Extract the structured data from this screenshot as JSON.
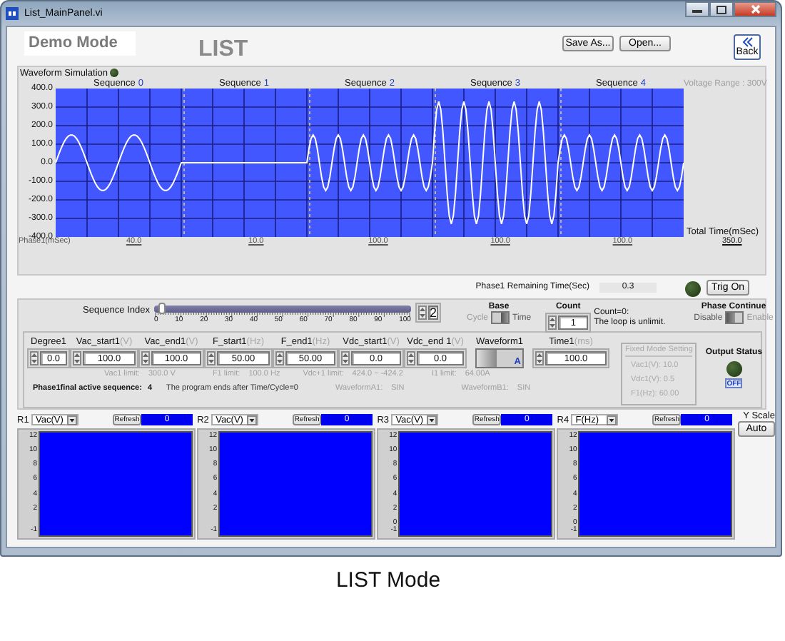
{
  "window": {
    "title": "List_MainPanel.vi"
  },
  "header": {
    "mode": "Demo Mode",
    "title": "LIST",
    "buttons": [
      "Save As...",
      "Open..."
    ],
    "back": "Back"
  },
  "waveform": {
    "label": "Waveform Simulation",
    "lit": false,
    "voltage_range": "Voltage Range : 300V",
    "sequences": [
      {
        "label": "Sequence",
        "number": "0",
        "duration": "40.0"
      },
      {
        "label": "Sequence",
        "number": "1",
        "duration": "10.0"
      },
      {
        "label": "Sequence",
        "number": "2",
        "duration": "100.0"
      },
      {
        "label": "Sequence",
        "number": "3",
        "duration": "100.0"
      },
      {
        "label": "Sequence",
        "number": "4",
        "duration": "100.0"
      }
    ],
    "y_ticks": [
      "400.0",
      "300.0",
      "200.0",
      "100.0",
      "0.0",
      "-100.0",
      "-200.0",
      "-300.0",
      "-400.0"
    ],
    "total_time_label": "Total Time(mSec)",
    "total_time": "350.0",
    "phase_label": "Phase1(mSec)"
  },
  "remaining": {
    "label": "Phase1 Remaining Time(Sec)",
    "value": "0.3"
  },
  "trigger": {
    "lit": false,
    "button": "Trig On"
  },
  "sequence_index": {
    "label": "Sequence Index",
    "level": 0.02,
    "ticks": [
      "0",
      "10",
      "20",
      "30",
      "40",
      "50",
      "60",
      "70",
      "80",
      "90",
      "100"
    ],
    "value": "2"
  },
  "base": {
    "label": "Base",
    "options": [
      {
        "label": "Cycle",
        "selected": false
      },
      {
        "label": "Time",
        "selected": true
      }
    ]
  },
  "count": {
    "label": "Count",
    "value": "1",
    "note": [
      "Count=0:",
      "The loop is unlimit."
    ]
  },
  "phase_continue": {
    "label": "Phase Continue",
    "options": [
      {
        "label": "Disable",
        "selected": true
      },
      {
        "label": "Enable",
        "selected": false
      }
    ]
  },
  "params": [
    {
      "kind": "numeric",
      "label": "Degree1",
      "value": "0.0"
    },
    {
      "kind": "numeric",
      "label": "Vac_start1",
      "unit": "(V)",
      "value": "100.0"
    },
    {
      "kind": "numeric",
      "label": "Vac_end1",
      "unit": "(V)",
      "value": "100.0"
    },
    {
      "kind": "numeric",
      "label": "F_start1",
      "unit": "(Hz)",
      "value": "50.00"
    },
    {
      "kind": "numeric",
      "label": "F_end1",
      "unit": "(Hz)",
      "value": "50.00"
    },
    {
      "kind": "numeric",
      "label": "Vdc_start1",
      "unit": "(V)",
      "value": "0.0"
    },
    {
      "kind": "numeric",
      "label": "Vdc_end 1",
      "unit": "(V)",
      "value": "0.0"
    },
    {
      "kind": "toggle",
      "label": "Waveform1",
      "option": "A",
      "on": false
    },
    {
      "kind": "numeric",
      "label": "Time1",
      "unit": "(ms)",
      "value": "100.0"
    }
  ],
  "limits": [
    {
      "label": "Vac1 limit:",
      "value": "300.0 V"
    },
    {
      "label": "F1 limit:",
      "value": "100.0 Hz"
    },
    {
      "label": "Vdc+1 limit:",
      "value": "424.0 ~ -424.2"
    },
    {
      "label": "I1 limit:",
      "value": "64.00A"
    }
  ],
  "info": {
    "active_label": "Phase1final active sequence:",
    "active_value": "4",
    "program_note": "The program ends after Time/Cycle=0",
    "waveforms": [
      {
        "label": "WaveformA1:",
        "value": "SIN"
      },
      {
        "label": "WaveformB1:",
        "value": "SIN"
      }
    ]
  },
  "fixed_mode": {
    "title": "Fixed Mode Setting",
    "disabled": true,
    "rows": [
      "Vac1(V):  10.0",
      "Vdc1(V):  0.5",
      "F1(Hz):  60.00"
    ]
  },
  "output": {
    "label": "Output Status",
    "lit": false,
    "button": "OFF"
  },
  "readouts": [
    {
      "label": "R1",
      "channel": "Vac(V)",
      "refresh": "Refresh",
      "value": "0",
      "ticks": [
        "12",
        "10",
        "8",
        "6",
        "4",
        "2",
        "-1"
      ]
    },
    {
      "label": "R2",
      "channel": "Vac(V)",
      "refresh": "Refresh",
      "value": "0",
      "ticks": [
        "12",
        "10",
        "8",
        "6",
        "4",
        "2",
        "-1"
      ]
    },
    {
      "label": "R3",
      "channel": "Vac(V)",
      "refresh": "Refresh",
      "value": "0",
      "ticks": [
        "12",
        "10",
        "8",
        "6",
        "4",
        "2",
        "0",
        "-1"
      ]
    },
    {
      "label": "R4",
      "channel": "F(Hz)",
      "refresh": "Refresh",
      "value": "0",
      "ticks": [
        "12",
        "10",
        "8",
        "6",
        "4",
        "2",
        "0",
        "-1"
      ]
    }
  ],
  "y_scale": {
    "label": "Y Scale",
    "button": "Auto"
  },
  "caption": "LIST Mode"
}
